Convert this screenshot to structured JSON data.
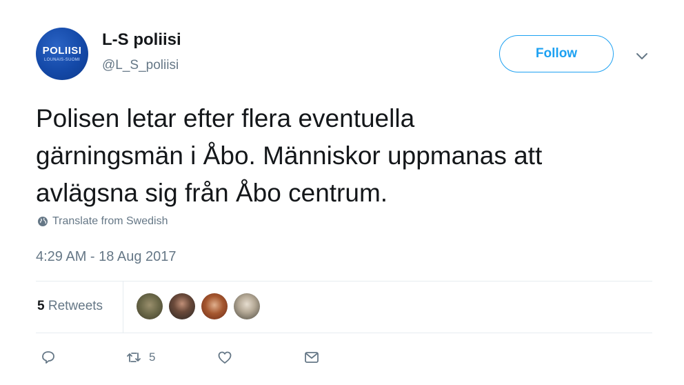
{
  "account": {
    "display_name": "L-S poliisi",
    "handle": "@L_S_poliisi",
    "avatar_text": "POLIISI",
    "avatar_subtext": "LOUNAIS-SUOMI"
  },
  "follow_button": {
    "label": "Follow"
  },
  "tweet": {
    "text": "Polisen letar efter flera eventuella\ngärningsmän i Åbo. Människor uppmanas att\navlägsna sig från Åbo centrum.",
    "translate_label": "Translate from Swedish",
    "timestamp": "4:29 AM - 18 Aug 2017"
  },
  "stats": {
    "retweet_count": "5",
    "retweet_label": "Retweets"
  },
  "actions": {
    "retweet_count": "5"
  },
  "colors": {
    "accent": "#1da1f2",
    "secondary_text": "#657786",
    "primary_text": "#14171a",
    "divider": "#e6ecf0"
  },
  "icons": [
    "globe-icon",
    "chevron-down-icon",
    "reply-icon",
    "retweet-icon",
    "like-icon",
    "message-icon"
  ]
}
